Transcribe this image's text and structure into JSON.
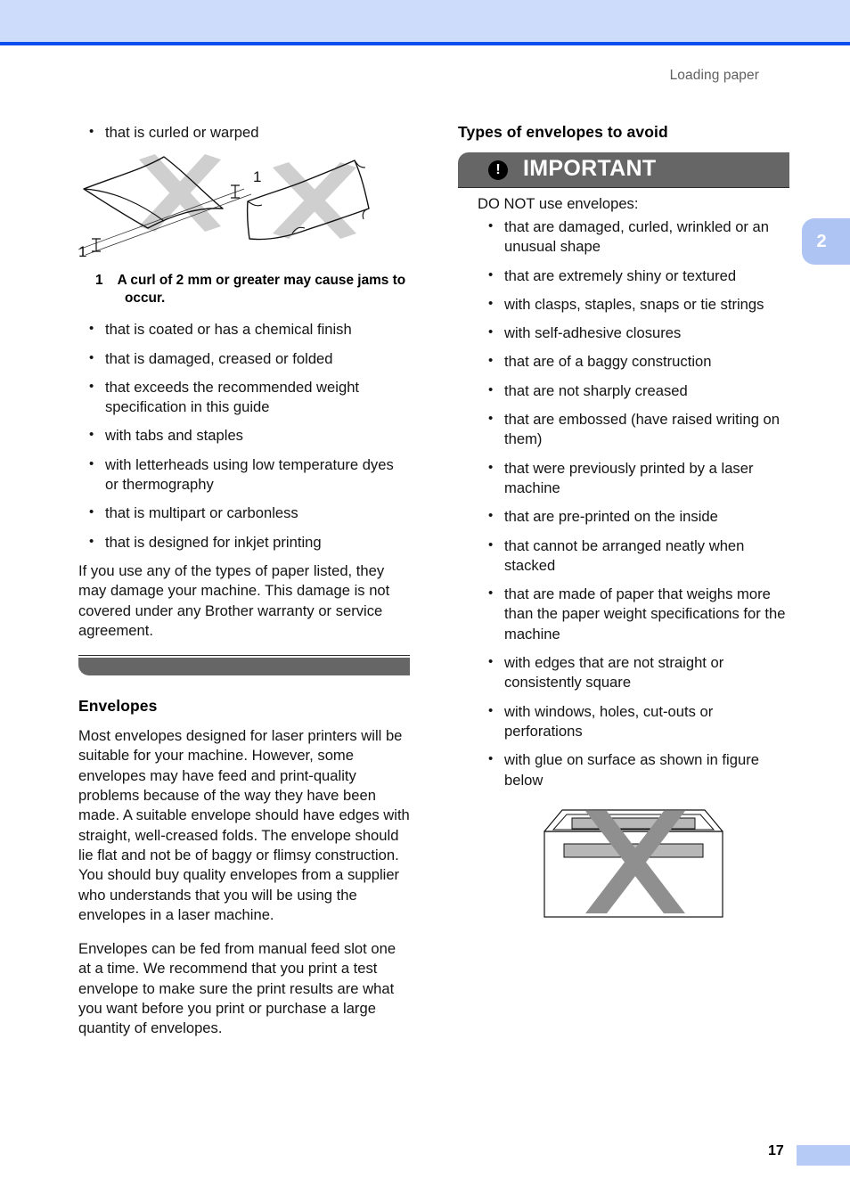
{
  "page": {
    "running_head": "Loading paper",
    "chapter_tab": "2",
    "folio": "17",
    "accent_header": "#ccdcfa",
    "accent_rule": "#0a4ef0",
    "accent_tab": "#aec4f2",
    "note_bar": "#666666"
  },
  "left_column": {
    "intro_bullets": [
      "that is curled or warped"
    ],
    "figure_curl": {
      "name": "curled-paper-figure",
      "callout_labels": [
        "1",
        "1"
      ],
      "caption_number": "1",
      "caption_text": "A curl of 2 mm or greater may cause jams to occur."
    },
    "paper_bullets": [
      "that is coated or has a chemical finish",
      "that is damaged, creased or folded",
      "that exceeds the recommended weight specification in this guide",
      "with tabs and staples",
      "with letterheads using low temperature dyes or thermography",
      "that is multipart or carbonless",
      "that is designed for inkjet printing"
    ],
    "warning_paragraph": "If you use any of the types of paper listed, they may damage your machine. This damage is not covered under any Brother warranty or service agreement.",
    "envelopes_heading": "Envelopes",
    "envelopes_paragraph_1": "Most envelopes designed for laser printers will be suitable for your machine. However, some envelopes may have feed and print-quality problems because of the way they have been made. A suitable envelope should have edges with straight, well-creased folds. The envelope should lie flat and not be of baggy or flimsy construction. You should buy quality envelopes from a supplier who understands that you will be using the envelopes in a laser machine.",
    "envelopes_paragraph_2": "Envelopes can be fed from manual feed slot one at a time. We recommend that you print a test envelope to make sure the print results are what you want before you print or purchase a large quantity of envelopes."
  },
  "right_column": {
    "heading": "Types of envelopes to avoid",
    "note": {
      "title": "IMPORTANT",
      "icon": "exclamation-icon",
      "lead": "DO NOT use envelopes:",
      "bullets": [
        "that are damaged, curled, wrinkled or an unusual shape",
        "that are extremely shiny or textured",
        "with clasps, staples, snaps or tie strings",
        "with self-adhesive closures",
        "that are of a baggy construction",
        "that are not sharply creased",
        "that are embossed (have raised writing on them)",
        "that were previously printed by a laser machine",
        "that are pre-printed on the inside",
        "that cannot be arranged neatly when stacked",
        "that are made of paper that weighs more than the paper weight specifications for the machine",
        "with edges that are not straight or consistently square",
        "with windows, holes, cut-outs or perforations",
        "with glue on surface as shown in figure below"
      ]
    },
    "figure_envelope": {
      "name": "envelope-with-glue-figure"
    }
  }
}
